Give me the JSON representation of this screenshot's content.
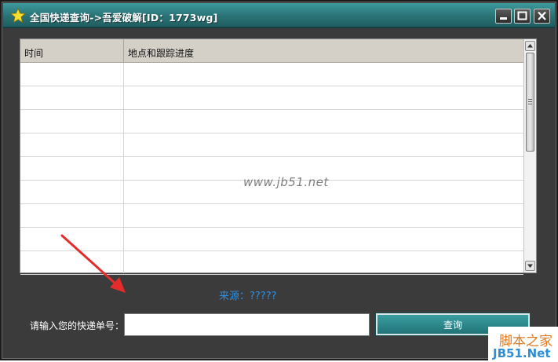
{
  "window": {
    "title": "全国快递查询->吾爱破解[ID：1773wg]",
    "accent_color": "#2a7275"
  },
  "controls": {
    "minimize_icon": "minimize-icon",
    "maximize_icon": "maximize-icon",
    "close_icon": "close-icon"
  },
  "table": {
    "columns": [
      "时间",
      "地点和跟踪进度"
    ],
    "rows": [
      [
        "",
        ""
      ],
      [
        "",
        ""
      ],
      [
        "",
        ""
      ],
      [
        "",
        ""
      ],
      [
        "",
        ""
      ],
      [
        "",
        ""
      ],
      [
        "",
        ""
      ],
      [
        "",
        ""
      ],
      [
        "",
        ""
      ]
    ]
  },
  "watermark": "www.jb51.net",
  "source": {
    "label": "来源：?????",
    "color": "#2e8fe0"
  },
  "form": {
    "input_label": "请输入您的快递单号：",
    "input_value": "",
    "input_placeholder": "",
    "query_button_label": "查询"
  },
  "logo": {
    "line1": "脚本之家",
    "line2": "JB51.Net"
  }
}
